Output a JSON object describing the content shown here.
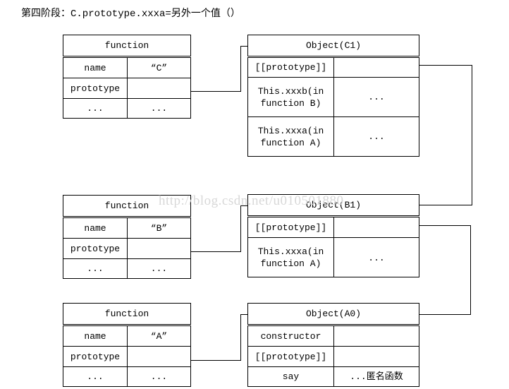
{
  "title": "第四阶段：C.prototype.xxxa=另外一个值（）",
  "watermark": "http://blog.csdn.net/u010501880",
  "groups": [
    {
      "id": "c",
      "function_table": {
        "header": "function",
        "rows": [
          {
            "key": "name",
            "value": "“C”"
          },
          {
            "key": "prototype",
            "value": ""
          },
          {
            "key": "...",
            "value": "..."
          }
        ]
      },
      "object_table": {
        "header": "Object(C1)",
        "rows": [
          {
            "key": "[[prototype]]",
            "value": ""
          },
          {
            "key": "This.xxxb(in function B)",
            "value": "..."
          },
          {
            "key": "This.xxxa(in function A)",
            "value": "..."
          }
        ]
      }
    },
    {
      "id": "b",
      "function_table": {
        "header": "function",
        "rows": [
          {
            "key": "name",
            "value": "“B”"
          },
          {
            "key": "prototype",
            "value": ""
          },
          {
            "key": "...",
            "value": "..."
          }
        ]
      },
      "object_table": {
        "header": "Object(B1)",
        "rows": [
          {
            "key": "[[prototype]]",
            "value": ""
          },
          {
            "key": "This.xxxa(in function A)",
            "value": "..."
          }
        ]
      }
    },
    {
      "id": "a",
      "function_table": {
        "header": "function",
        "rows": [
          {
            "key": "name",
            "value": "“A”"
          },
          {
            "key": "prototype",
            "value": ""
          },
          {
            "key": "...",
            "value": "..."
          }
        ]
      },
      "object_table": {
        "header": "Object(A0)",
        "rows": [
          {
            "key": "constructor",
            "value": ""
          },
          {
            "key": "[[prototype]]",
            "value": ""
          },
          {
            "key": "say",
            "value": "...匿名函数"
          }
        ]
      }
    }
  ],
  "colors": {
    "line": "#000000",
    "background": "#ffffff",
    "watermark": "#d8d8d8"
  }
}
